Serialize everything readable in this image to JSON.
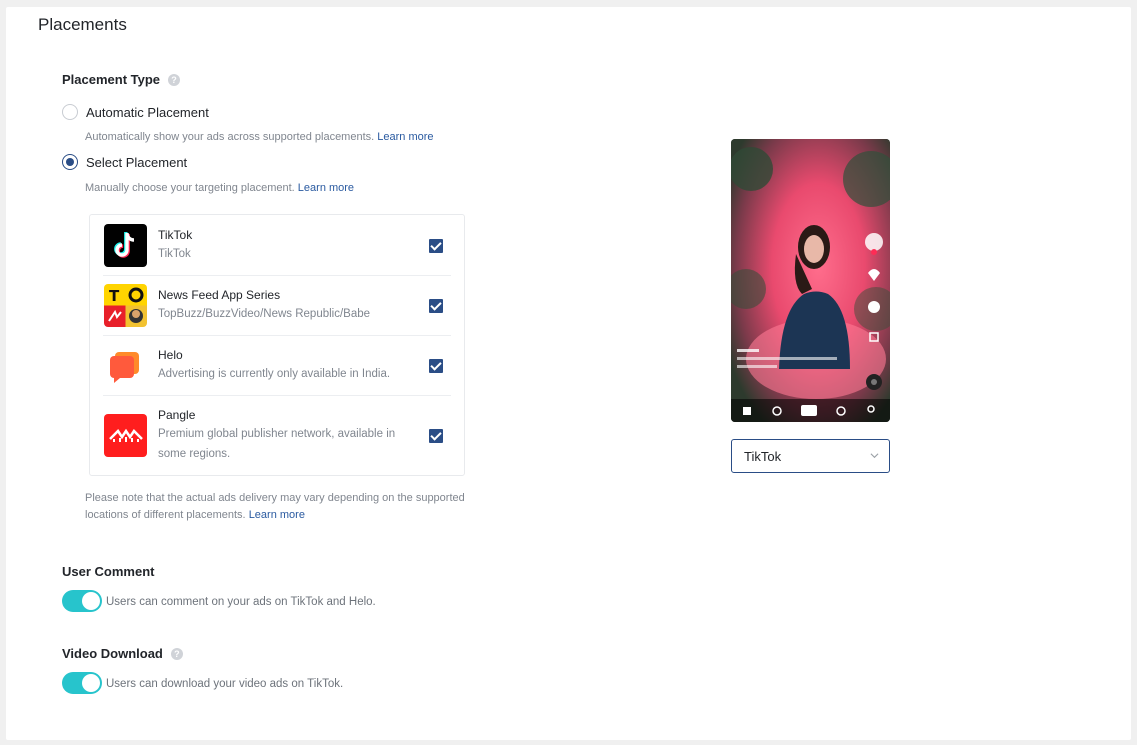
{
  "section_title": "Placements",
  "placement_type": {
    "label": "Placement Type",
    "options": [
      {
        "label": "Automatic Placement",
        "hint": "Automatically show your ads across supported placements.",
        "link": "Learn more",
        "selected": false
      },
      {
        "label": "Select Placement",
        "hint": "Manually choose your targeting placement.",
        "link": "Learn more",
        "selected": true
      }
    ]
  },
  "placements": [
    {
      "name": "TikTok",
      "desc": "TikTok",
      "icon": "tiktok-logo",
      "checked": true
    },
    {
      "name": "News Feed App Series",
      "desc": "TopBuzz/BuzzVideo/News Republic/Babe",
      "icon": "news-feed-logo",
      "checked": true
    },
    {
      "name": "Helo",
      "desc": "Advertising is currently only available in India.",
      "icon": "helo-logo",
      "checked": true
    },
    {
      "name": "Pangle",
      "desc": "Premium global publisher network, available in some regions.",
      "icon": "pangle-logo",
      "checked": true
    }
  ],
  "note": {
    "line1": "Please note that the actual ads delivery may vary depending on the supported",
    "line2": "locations of different placements.",
    "link": "Learn more"
  },
  "user_comment": {
    "label": "User Comment",
    "hint": "Users can comment on your ads on TikTok and Helo.",
    "enabled": true
  },
  "video_download": {
    "label": "Video Download",
    "hint": "Users can download your video ads on TikTok.",
    "enabled": true
  },
  "preview": {
    "selected": "TikTok"
  },
  "colors": {
    "accent": "#2a4d86",
    "toggle": "#27c4cc",
    "link": "#2a5aa0"
  }
}
